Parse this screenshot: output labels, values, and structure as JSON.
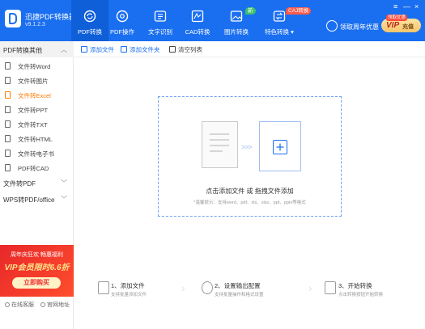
{
  "app": {
    "name": "迅捷PDF转换器",
    "version": "v9.1.2.3"
  },
  "nav": [
    {
      "label": "PDF转换",
      "icon": "refresh-icon"
    },
    {
      "label": "PDF操作",
      "icon": "gear-doc-icon"
    },
    {
      "label": "文字识别",
      "icon": "ocr-icon"
    },
    {
      "label": "CAD转换",
      "icon": "cad-icon"
    },
    {
      "label": "图片转换",
      "icon": "image-icon"
    },
    {
      "label": "特色转换 ▾",
      "icon": "swap-icon"
    }
  ],
  "badges": {
    "new": "新",
    "caj": "CAJ转换"
  },
  "header": {
    "user_text": "领取周年优惠",
    "vip_label": "VIP",
    "vip_action": "充值",
    "vip_tag": "领取优惠"
  },
  "window_controls": [
    "≡",
    "—",
    "×"
  ],
  "sidebar": {
    "section1": "PDF转换其他",
    "items": [
      "文件转Word",
      "文件转图片",
      "文件转Excel",
      "文件转PPT",
      "文件转TXT",
      "文件转HTML",
      "文件转电子书",
      "PDF转CAD"
    ],
    "section2": "文件转PDF",
    "section3": "WPS转PDF/office",
    "promo": {
      "line1": "周年庆狂欢 畅惠福利",
      "line2": "VIP会员限时6.6折",
      "button": "立即购买"
    },
    "footer": {
      "service": "在线客服",
      "website": "官网地址"
    }
  },
  "toolbar": {
    "add_file": "添加文件",
    "add_folder": "添加文件夹",
    "clear": "清空列表"
  },
  "dropzone": {
    "title": "点击添加文件 或 拖拽文件添加",
    "subtitle": "*温馨提示：支持word、pdf、xls、xlsx、ppt、pptx等格式"
  },
  "steps": [
    {
      "title": "1、添加文件",
      "desc": "支持批量添加文件"
    },
    {
      "title": "2、设置输出配置",
      "desc": "支持批量操作和格式设置"
    },
    {
      "title": "3、开始转换",
      "desc": "点击转换按钮开始转换"
    }
  ]
}
